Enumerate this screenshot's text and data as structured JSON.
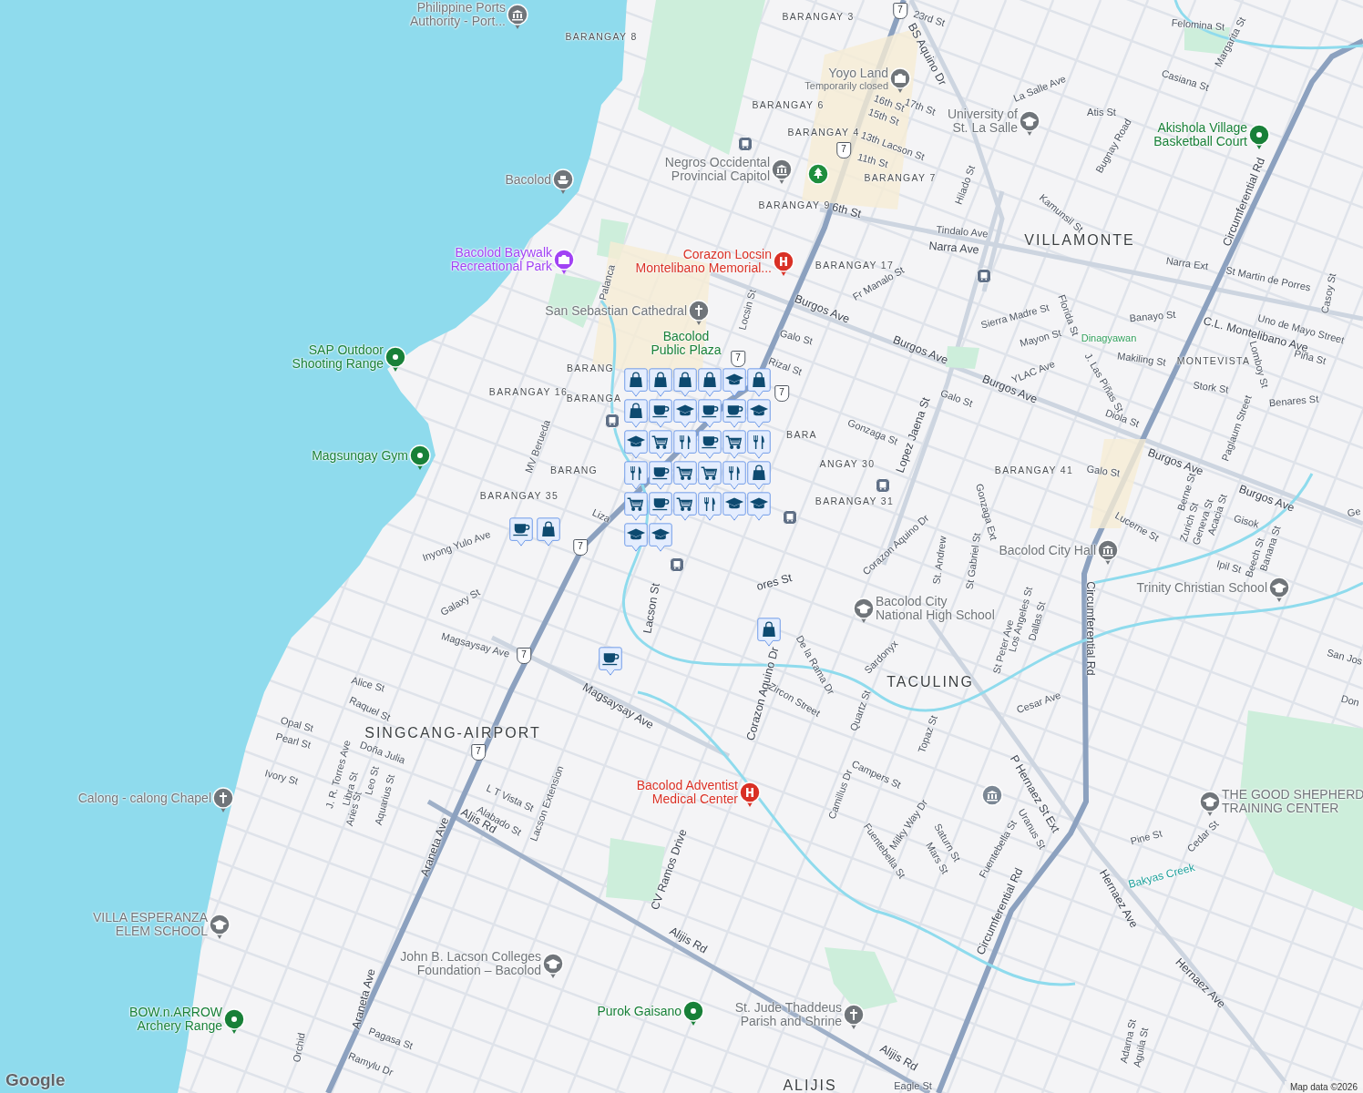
{
  "map": {
    "places": [
      {
        "kind": "government",
        "lines": [
          "Philippine Ports",
          "Authority - Port..."
        ],
        "color": "#70757a"
      },
      {
        "kind": "attraction",
        "lines": [
          "Yoyo Land"
        ],
        "note": "Temporarily closed",
        "color": "#70757a"
      },
      {
        "kind": "school",
        "lines": [
          "University of",
          "St. La Salle"
        ],
        "color": "#70757a"
      },
      {
        "kind": "sports",
        "lines": [
          "Akishola Village",
          "Basketball Court"
        ],
        "color": "#188038"
      },
      {
        "kind": "ferry",
        "lines": [
          "Bacolod"
        ],
        "color": "#70757a"
      },
      {
        "kind": "government",
        "lines": [
          "Negros Occidental",
          "Provincial Capitol"
        ],
        "color": "#70757a"
      },
      {
        "kind": "attraction",
        "lines": [
          "Bacolod Baywalk",
          "Recreational Park"
        ],
        "color": "#a142f4"
      },
      {
        "kind": "hospital",
        "lines": [
          "Corazon Locsin",
          "Montelibano Memorial..."
        ],
        "color": "#d93025"
      },
      {
        "kind": "church",
        "lines": [
          "San Sebastian Cathedral"
        ],
        "color": "#70757a"
      },
      {
        "kind": "sports",
        "lines": [
          "SAP Outdoor",
          "Shooting Range"
        ],
        "color": "#188038"
      },
      {
        "kind": "plaza",
        "lines": [
          "Bacolod",
          "Public Plaza"
        ],
        "color": "#188038"
      },
      {
        "kind": "sports",
        "lines": [
          "Magsungay Gym"
        ],
        "color": "#188038"
      },
      {
        "kind": "government",
        "lines": [
          "Bacolod City Hall"
        ],
        "color": "#70757a"
      },
      {
        "kind": "school",
        "lines": [
          "Trinity Christian School"
        ],
        "color": "#70757a"
      },
      {
        "kind": "school",
        "lines": [
          "Bacolod City",
          "National High School"
        ],
        "color": "#70757a"
      },
      {
        "kind": "church",
        "lines": [
          "Calong - calong Chapel"
        ],
        "color": "#70757a"
      },
      {
        "kind": "hospital",
        "lines": [
          "Bacolod Adventist",
          "Medical Center"
        ],
        "color": "#d93025"
      },
      {
        "kind": "school",
        "lines": [
          "THE GOOD SHEPHERD",
          "TRAINING CENTER"
        ],
        "color": "#70757a"
      },
      {
        "kind": "school",
        "lines": [
          "VILLA ESPERANZA",
          "ELEM SCHOOL"
        ],
        "color": "#70757a"
      },
      {
        "kind": "school",
        "lines": [
          "John B. Lacson Colleges",
          "Foundation – Bacolod"
        ],
        "color": "#70757a"
      },
      {
        "kind": "sports",
        "lines": [
          "BOW.n.ARROW",
          "Archery Range"
        ],
        "color": "#188038"
      },
      {
        "kind": "sports",
        "lines": [
          "Purok Gaisano"
        ],
        "color": "#188038"
      },
      {
        "kind": "church",
        "lines": [
          "St. Jude Thaddeus",
          "Parish and Shrine"
        ],
        "color": "#70757a"
      }
    ],
    "areas": [
      {
        "name": "BARANGAY 3",
        "kind": "barangay"
      },
      {
        "name": "BARANGAY 8",
        "kind": "barangay"
      },
      {
        "name": "BARANGAY 6",
        "kind": "barangay"
      },
      {
        "name": "BARANGAY 4",
        "kind": "barangay"
      },
      {
        "name": "BARANGAY 7",
        "kind": "barangay"
      },
      {
        "name": "BARANGAY 9",
        "kind": "barangay"
      },
      {
        "name": "VILLAMONTE",
        "kind": "district"
      },
      {
        "name": "BARANGAY 17",
        "kind": "barangay"
      },
      {
        "name": "MONTEVISTA",
        "kind": "barangay"
      },
      {
        "name": "BARANG",
        "kind": "barangay"
      },
      {
        "name": "BARANGAY 16",
        "kind": "barangay"
      },
      {
        "name": "BARANGA",
        "kind": "barangay"
      },
      {
        "name": "BARA",
        "kind": "barangay"
      },
      {
        "name": "BARANG",
        "kind": "barangay"
      },
      {
        "name": "ANGAY 30",
        "kind": "barangay"
      },
      {
        "name": "BARANGAY 41",
        "kind": "barangay"
      },
      {
        "name": "BARANGAY 35",
        "kind": "barangay"
      },
      {
        "name": "BARANGAY 31",
        "kind": "barangay"
      },
      {
        "name": "TACULING",
        "kind": "district"
      },
      {
        "name": "SINGCANG-AIRPORT",
        "kind": "district"
      },
      {
        "name": "ALIJIS",
        "kind": "district"
      }
    ],
    "streets": [
      {
        "name": "23rd St",
        "kind": "street"
      },
      {
        "name": "BS Aquino Dr",
        "kind": "major"
      },
      {
        "name": "16th St",
        "kind": "street"
      },
      {
        "name": "17th St",
        "kind": "street"
      },
      {
        "name": "15th St",
        "kind": "street"
      },
      {
        "name": "13th Lacson St",
        "kind": "street"
      },
      {
        "name": "11th St",
        "kind": "street"
      },
      {
        "name": "6th St",
        "kind": "major"
      },
      {
        "name": "Hilado St",
        "kind": "street"
      },
      {
        "name": "Tindalo Ave",
        "kind": "street"
      },
      {
        "name": "Narra Ave",
        "kind": "major"
      },
      {
        "name": "La Salle Ave",
        "kind": "street"
      },
      {
        "name": "Atis St",
        "kind": "street"
      },
      {
        "name": "Bugnay Road",
        "kind": "street"
      },
      {
        "name": "Kamunsil St",
        "kind": "street"
      },
      {
        "name": "Felomina St",
        "kind": "street"
      },
      {
        "name": "Margarita St",
        "kind": "street"
      },
      {
        "name": "Casiana St",
        "kind": "street"
      },
      {
        "name": "Circumferential Rd",
        "kind": "major"
      },
      {
        "name": "Narra Ext",
        "kind": "street"
      },
      {
        "name": "St Martin de Porres",
        "kind": "street"
      },
      {
        "name": "Casoy St",
        "kind": "street"
      },
      {
        "name": "Uno de Mayo Street",
        "kind": "street"
      },
      {
        "name": "C.L. Montelibano Ave",
        "kind": "major"
      },
      {
        "name": "Piña St",
        "kind": "street"
      },
      {
        "name": "Lomboy St",
        "kind": "street"
      },
      {
        "name": "Stork St",
        "kind": "street"
      },
      {
        "name": "Benares St",
        "kind": "street"
      },
      {
        "name": "Banayo St",
        "kind": "street"
      },
      {
        "name": "Sierra Madre St",
        "kind": "street"
      },
      {
        "name": "Florida St",
        "kind": "street"
      },
      {
        "name": "Mayon St",
        "kind": "street"
      },
      {
        "name": "Dinagyawan",
        "kind": "park"
      },
      {
        "name": "YLAC Ave",
        "kind": "street"
      },
      {
        "name": "Makiling St",
        "kind": "street"
      },
      {
        "name": "J. Las Piñas St",
        "kind": "street"
      },
      {
        "name": "Diola St",
        "kind": "street"
      },
      {
        "name": "Burgos Ave",
        "kind": "major"
      },
      {
        "name": "Burgos Ave",
        "kind": "major"
      },
      {
        "name": "Burgos Ave",
        "kind": "major"
      },
      {
        "name": "Burgos Ave",
        "kind": "major"
      },
      {
        "name": "Burgos Ave",
        "kind": "major"
      },
      {
        "name": "Galo St",
        "kind": "street"
      },
      {
        "name": "Galo St",
        "kind": "street"
      },
      {
        "name": "Galo St",
        "kind": "street"
      },
      {
        "name": "Rizal St",
        "kind": "street"
      },
      {
        "name": "Locsin St",
        "kind": "street"
      },
      {
        "name": "Fr Manalo St",
        "kind": "street"
      },
      {
        "name": "Gonzaga St",
        "kind": "street"
      },
      {
        "name": "Lopez Jaena St",
        "kind": "major"
      },
      {
        "name": "Paglaum Street",
        "kind": "street"
      },
      {
        "name": "Lucerne St",
        "kind": "street"
      },
      {
        "name": "Berne St",
        "kind": "street"
      },
      {
        "name": "Zurich St",
        "kind": "street"
      },
      {
        "name": "Geneva St",
        "kind": "street"
      },
      {
        "name": "Acacia St",
        "kind": "street"
      },
      {
        "name": "Gisok",
        "kind": "street"
      },
      {
        "name": "Beech St",
        "kind": "street"
      },
      {
        "name": "Banana St",
        "kind": "street"
      },
      {
        "name": "Ipil St",
        "kind": "street"
      },
      {
        "name": "Ge",
        "kind": "street"
      },
      {
        "name": "San Jos",
        "kind": "street"
      },
      {
        "name": "Don",
        "kind": "street"
      },
      {
        "name": "Gonzaga Ext",
        "kind": "street"
      },
      {
        "name": "St Gabriel St",
        "kind": "street"
      },
      {
        "name": "St. Andrew",
        "kind": "street"
      },
      {
        "name": "Corazon Aquino Dr",
        "kind": "street"
      },
      {
        "name": "Los Angeles St",
        "kind": "street"
      },
      {
        "name": "Dallas St",
        "kind": "street"
      },
      {
        "name": "St Peter Ave",
        "kind": "street"
      },
      {
        "name": "Sardonyx",
        "kind": "street"
      },
      {
        "name": "De la Rama Dr",
        "kind": "street"
      },
      {
        "name": "Corazon Aquino Dr",
        "kind": "major"
      },
      {
        "name": "Zircon Street",
        "kind": "street"
      },
      {
        "name": "Quartz St",
        "kind": "street"
      },
      {
        "name": "Cesar Ave",
        "kind": "street"
      },
      {
        "name": "Topaz St",
        "kind": "street"
      },
      {
        "name": "Campers St",
        "kind": "street"
      },
      {
        "name": "Camillus Dr",
        "kind": "street"
      },
      {
        "name": "Milky Way Dr",
        "kind": "street"
      },
      {
        "name": "Saturn St",
        "kind": "street"
      },
      {
        "name": "Mars St",
        "kind": "street"
      },
      {
        "name": "Fuentebella St",
        "kind": "street"
      },
      {
        "name": "Fuentebella St",
        "kind": "street"
      },
      {
        "name": "Uranus St",
        "kind": "street"
      },
      {
        "name": "P Hernaez St Ext",
        "kind": "major"
      },
      {
        "name": "Hernaez Ave",
        "kind": "major"
      },
      {
        "name": "Hernaez Ave",
        "kind": "major"
      },
      {
        "name": "Pine St",
        "kind": "street"
      },
      {
        "name": "Cedar St",
        "kind": "street"
      },
      {
        "name": "Bakyas Creek",
        "kind": "creek"
      },
      {
        "name": "Circumferential Rd",
        "kind": "major"
      },
      {
        "name": "Circumferential Rd",
        "kind": "major"
      },
      {
        "name": "Adarna St",
        "kind": "street"
      },
      {
        "name": "Aguila St",
        "kind": "street"
      },
      {
        "name": "Eagle St",
        "kind": "street"
      },
      {
        "name": "Palanca",
        "kind": "street"
      },
      {
        "name": "MV Berueda",
        "kind": "street"
      },
      {
        "name": "Liza",
        "kind": "street"
      },
      {
        "name": "Inyong Yulo Ave",
        "kind": "street"
      },
      {
        "name": "Galaxy St",
        "kind": "street"
      },
      {
        "name": "Magsaysay Ave",
        "kind": "street"
      },
      {
        "name": "Magsaysay Ave",
        "kind": "major"
      },
      {
        "name": "Lacson St",
        "kind": "major"
      },
      {
        "name": "ores St",
        "kind": "major"
      },
      {
        "name": "Alice St",
        "kind": "street"
      },
      {
        "name": "Raquel St",
        "kind": "street"
      },
      {
        "name": "Opal St",
        "kind": "street"
      },
      {
        "name": "Pearl St",
        "kind": "street"
      },
      {
        "name": "Doña Julia",
        "kind": "street"
      },
      {
        "name": "Ivory St",
        "kind": "street"
      },
      {
        "name": "J. R. Torres Ave",
        "kind": "street"
      },
      {
        "name": "Libra St",
        "kind": "street"
      },
      {
        "name": "Aries St",
        "kind": "street"
      },
      {
        "name": "Leo St",
        "kind": "street"
      },
      {
        "name": "Aquarius St",
        "kind": "street"
      },
      {
        "name": "L T Vista St",
        "kind": "street"
      },
      {
        "name": "Alabado St",
        "kind": "street"
      },
      {
        "name": "Lacson Extension",
        "kind": "street"
      },
      {
        "name": "Aljis Rd",
        "kind": "major"
      },
      {
        "name": "CV Ramos Drive",
        "kind": "major"
      },
      {
        "name": "Araneta Ave",
        "kind": "major"
      },
      {
        "name": "Araneta Ave",
        "kind": "major"
      },
      {
        "name": "Alijis Rd",
        "kind": "major"
      },
      {
        "name": "Alijis Rd",
        "kind": "major"
      },
      {
        "name": "Orchid",
        "kind": "street"
      },
      {
        "name": "Pagasa St",
        "kind": "street"
      },
      {
        "name": "Ramylu Dr",
        "kind": "street"
      }
    ],
    "route_shields": [
      "7",
      "7",
      "7",
      "7",
      "7",
      "7",
      "7"
    ],
    "pins": [
      {
        "kind": "shopping"
      },
      {
        "kind": "shopping"
      },
      {
        "kind": "shopping"
      },
      {
        "kind": "shopping"
      },
      {
        "kind": "school"
      },
      {
        "kind": "shopping"
      },
      {
        "kind": "shopping"
      },
      {
        "kind": "cafe"
      },
      {
        "kind": "school"
      },
      {
        "kind": "cafe"
      },
      {
        "kind": "cafe"
      },
      {
        "kind": "school"
      },
      {
        "kind": "school"
      },
      {
        "kind": "grocery"
      },
      {
        "kind": "restaurant"
      },
      {
        "kind": "cafe"
      },
      {
        "kind": "grocery"
      },
      {
        "kind": "restaurant"
      },
      {
        "kind": "restaurant"
      },
      {
        "kind": "cafe"
      },
      {
        "kind": "grocery"
      },
      {
        "kind": "cafe"
      },
      {
        "kind": "shopping"
      },
      {
        "kind": "grocery"
      },
      {
        "kind": "restaurant"
      },
      {
        "kind": "shopping"
      },
      {
        "kind": "grocery"
      },
      {
        "kind": "cafe"
      },
      {
        "kind": "grocery"
      },
      {
        "kind": "restaurant"
      },
      {
        "kind": "school"
      },
      {
        "kind": "school"
      },
      {
        "kind": "school"
      },
      {
        "kind": "school"
      },
      {
        "kind": "shopping"
      },
      {
        "kind": "cafe"
      }
    ]
  },
  "attribution": {
    "logo": "Google",
    "text": "Map data ©2026"
  }
}
